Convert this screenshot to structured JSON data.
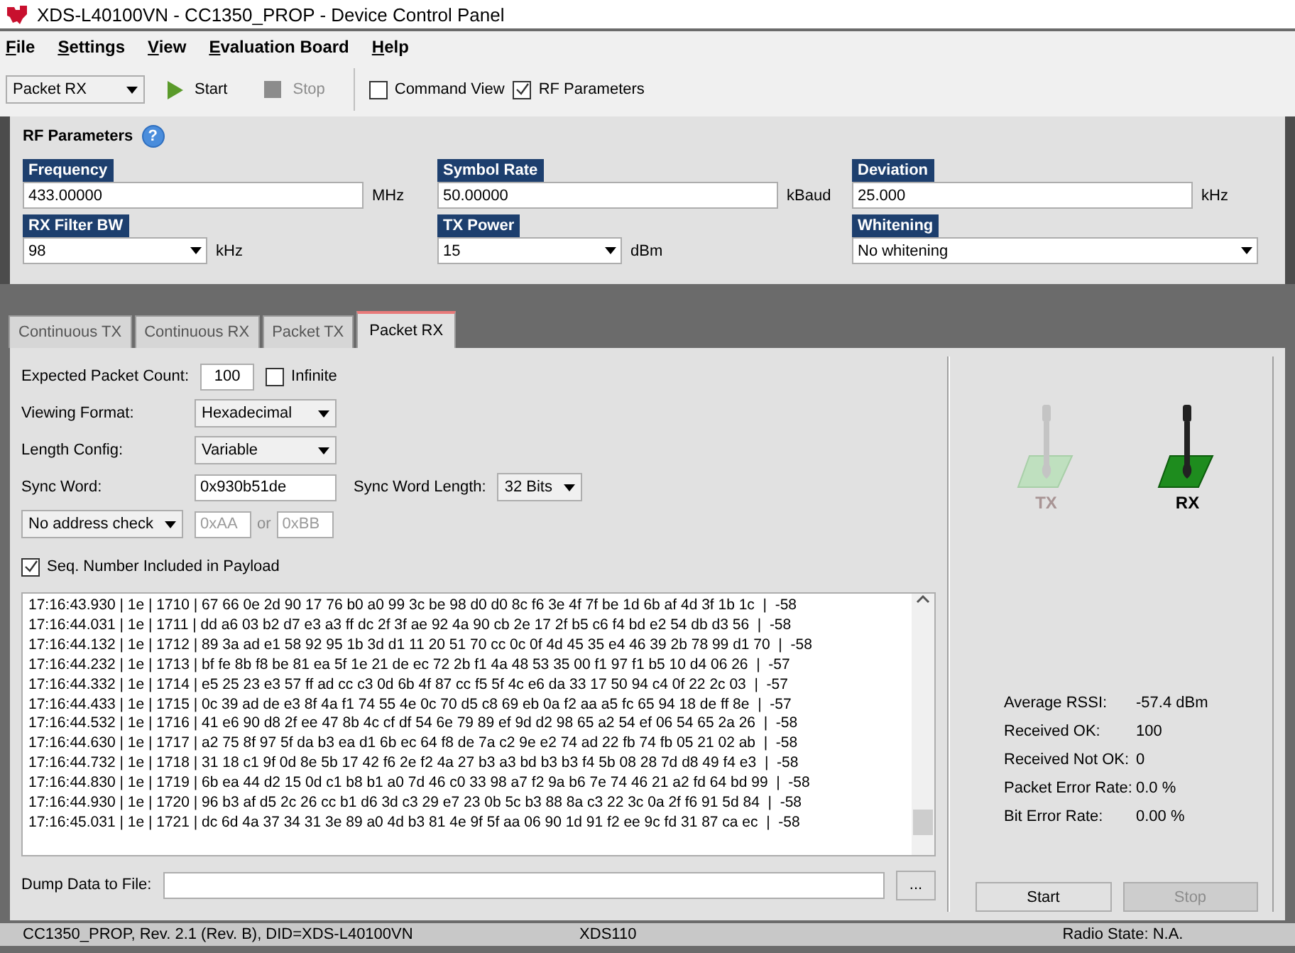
{
  "window": {
    "title": "XDS-L40100VN - CC1350_PROP - Device Control Panel"
  },
  "menu": [
    {
      "label": "File"
    },
    {
      "label": "Settings"
    },
    {
      "label": "View"
    },
    {
      "label": "Evaluation Board"
    },
    {
      "label": "Help"
    }
  ],
  "toolbar": {
    "mode": "Packet RX",
    "start": {
      "label": "Start",
      "disabled": false
    },
    "stop": {
      "label": "Stop",
      "disabled": true
    },
    "checks": [
      {
        "label": "Command View",
        "checked": false
      },
      {
        "label": "RF Parameters",
        "checked": true
      }
    ]
  },
  "rf_parameters": {
    "title": "RF Parameters",
    "help": "?",
    "fields": [
      {
        "label": "Frequency",
        "kind": "input",
        "value": "433.00000",
        "unit": "MHz"
      },
      {
        "label": "Symbol Rate",
        "kind": "input",
        "value": "50.00000",
        "unit": "kBaud"
      },
      {
        "label": "Deviation",
        "kind": "input",
        "value": "25.000",
        "unit": "kHz"
      },
      {
        "label": "RX Filter BW",
        "kind": "select",
        "value": "98",
        "unit": "kHz"
      },
      {
        "label": "TX Power",
        "kind": "select",
        "value": "15",
        "unit": "dBm"
      },
      {
        "label": "Whitening",
        "kind": "select",
        "value": "No whitening"
      }
    ]
  },
  "tabs": [
    {
      "label": "Continuous TX",
      "selected": false
    },
    {
      "label": "Continuous RX",
      "selected": false
    },
    {
      "label": "Packet TX",
      "selected": false
    },
    {
      "label": "Packet RX",
      "selected": true
    }
  ],
  "packet_rx": {
    "expected_count_label": "Expected Packet Count:",
    "expected_count": "100",
    "infinite": {
      "label": "Infinite",
      "checked": false
    },
    "viewing_format_label": "Viewing Format:",
    "viewing_format": "Hexadecimal",
    "length_config_label": "Length Config:",
    "length_config": "Variable",
    "sync_word_label": "Sync Word:",
    "sync_word": "0x930b51de",
    "sync_length_label": "Sync Word Length:",
    "sync_length": "32 Bits",
    "address_check": "No address check",
    "address_1": {
      "placeholder": "0xAA"
    },
    "or": "or",
    "address_2": {
      "placeholder": "0xBB"
    },
    "seq_number": {
      "label": "Seq. Number Included in Payload",
      "checked": true
    },
    "log": [
      "17:16:43.930 | 1e | 1710 | 67 66 0e 2d 90 17 76 b0 a0 99 3c be 98 d0 d0 8c f6 3e 4f 7f be 1d 6b af 4d 3f 1b 1c  |  -58",
      "17:16:44.031 | 1e | 1711 | dd a6 03 b2 d7 e3 a3 ff dc 2f 3f ae 92 4a 90 cb 2e 17 2f b5 c6 f4 bd e2 54 db d3 56  |  -58",
      "17:16:44.132 | 1e | 1712 | 89 3a ad e1 58 92 95 1b 3d d1 11 20 51 70 cc 0c 0f 4d 45 35 e4 46 39 2b 78 99 d1 70  |  -58",
      "17:16:44.232 | 1e | 1713 | bf fe 8b f8 be 81 ea 5f 1e 21 de ec 72 2b f1 4a 48 53 35 00 f1 97 f1 b5 10 d4 06 26  |  -57",
      "17:16:44.332 | 1e | 1714 | e5 25 23 e3 57 ff ad cc c3 0d 6b 4f 87 cc f5 5f 4c e6 da 33 17 50 94 c4 0f 22 2c 03  |  -57",
      "17:16:44.433 | 1e | 1715 | 0c 39 ad de e3 8f 4a f1 74 55 4e 0c 70 d5 c8 69 eb 0a f2 aa a5 fc 65 94 18 de ff 8e  |  -57",
      "17:16:44.532 | 1e | 1716 | 41 e6 90 d8 2f ee 47 8b 4c cf df 54 6e 79 89 ef 9d d2 98 65 a2 54 ef 06 54 65 2a 26  |  -58",
      "17:16:44.630 | 1e | 1717 | a2 75 8f 97 5f da b3 ea d1 6b ec 64 f8 de 7a c2 9e e2 74 ad 22 fb 74 fb 05 21 02 ab  |  -58",
      "17:16:44.732 | 1e | 1718 | 31 18 c1 9f 0d 8e 5b 17 42 f6 2e f2 4a 27 b3 a3 bd b3 b3 f4 5b 08 28 7d d8 49 f4 e3  |  -58",
      "17:16:44.830 | 1e | 1719 | 6b ea 44 d2 15 0d c1 b8 b1 a0 7d 46 c0 33 98 a7 f2 9a b6 7e 74 46 21 a2 fd 64 bd 99  |  -58",
      "17:16:44.930 | 1e | 1720 | 96 b3 af d5 2c 26 cc b1 d6 3d c3 29 e7 23 0b 5c b3 88 8a c3 22 3c 0a 2f f6 91 5d 84  |  -58",
      "17:16:45.031 | 1e | 1721 | dc 6d 4a 37 34 31 3e 89 a0 4d b3 81 4e 9f 5f aa 06 90 1d 91 f2 ee 9c fd 31 87 ca ec  |  -58"
    ],
    "dump_label": "Dump Data to File:",
    "browse": "..."
  },
  "antennas": [
    {
      "label": "TX",
      "active": false
    },
    {
      "label": "RX",
      "active": true
    }
  ],
  "stats": [
    {
      "label": "Average RSSI:",
      "value": "-57.4 dBm"
    },
    {
      "label": "Received OK:",
      "value": "100"
    },
    {
      "label": "Received Not OK:",
      "value": "0"
    },
    {
      "label": "Packet Error Rate:",
      "value": "0.0 %"
    },
    {
      "label": "Bit Error Rate:",
      "value": "0.00 %"
    }
  ],
  "buttons": [
    {
      "label": "Start",
      "disabled": false
    },
    {
      "label": "Stop",
      "disabled": true
    }
  ],
  "status_bar": [
    "CC1350_PROP, Rev. 2.1 (Rev. B), DID=XDS-L40100VN",
    "XDS110",
    "Radio State: N.A."
  ]
}
